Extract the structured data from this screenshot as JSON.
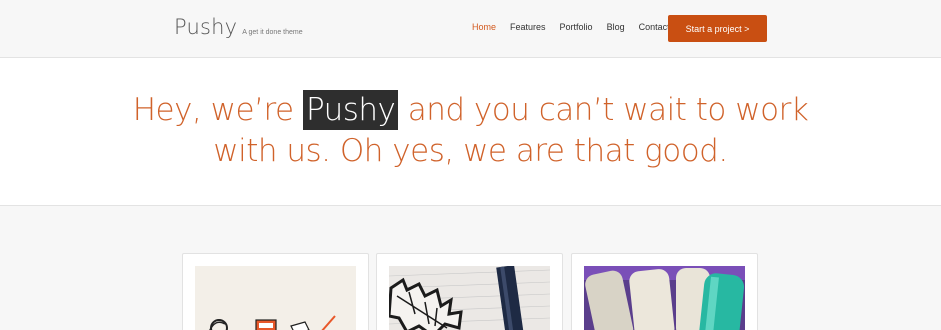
{
  "header": {
    "brand_name": "Pushy",
    "tagline": "A get it done theme",
    "nav": [
      {
        "label": "Home",
        "active": true
      },
      {
        "label": "Features",
        "active": false
      },
      {
        "label": "Portfolio",
        "active": false
      },
      {
        "label": "Blog",
        "active": false
      },
      {
        "label": "Contact",
        "active": false
      }
    ],
    "cta_label": "Start a project >"
  },
  "hero": {
    "before": "Hey, we’re ",
    "highlight": "Pushy",
    "line1_after": " and you can’t wait to work",
    "line2": "with us. Oh yes, we are that good."
  },
  "colors": {
    "accent": "#d35a1f",
    "button": "#c94f12",
    "highlight_bg": "#2e2e2e"
  }
}
